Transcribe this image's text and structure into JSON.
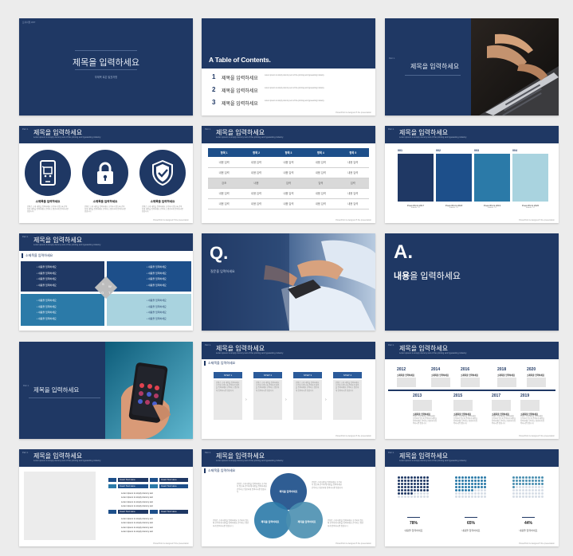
{
  "common": {
    "title": "제목을 입력하세요",
    "subtitle_line": "Lorem ipsum is simply dummy text of the printing and typesetting industry.",
    "footer": "PowerPoint is designed 5 the presentation",
    "page": "Part 1.",
    "content": "내용을 입력하세요",
    "small_title": "소제목을 입력하세요",
    "lorem": "Lorem ipsum is simply dummy text of the printing and typesetting industry.",
    "kor_lorem": "콘텐츠 소개 내용을 입력하세요 조각하지 않도록 간략하게 내용을 입력하세요 간략하고 명료하게 입력하시면 좋습니다"
  },
  "slide1": {
    "top_label": "프리미엄 PPT",
    "title": "제목을 입력하세요",
    "sub": "부제목 혹은 발표자명"
  },
  "slide2": {
    "heading": "A Table of Contents.",
    "items": [
      {
        "num": "1",
        "label": "제목을 입력하세요"
      },
      {
        "num": "2",
        "label": "제목을 입력하세요"
      },
      {
        "num": "3",
        "label": "제목을 입력하세요"
      }
    ]
  },
  "slide3": {
    "title": "제목을 입력하세요"
  },
  "slide4": {
    "title": "제목을 입력하세요",
    "items": [
      {
        "icon": "mobile-shopping-cart-icon",
        "label": "소제목을 입력하세요"
      },
      {
        "icon": "padlock-icon",
        "label": "소제목을 입력하세요"
      },
      {
        "icon": "shield-check-icon",
        "label": "소제목을 입력하세요"
      }
    ]
  },
  "slide5": {
    "title": "제목을 입력하세요",
    "columns": [
      "항목 1",
      "항목 2",
      "항목 3",
      "항목 4",
      "항목 5"
    ],
    "rows": [
      [
        "내용 입력",
        "내용 입력",
        "내용 입력",
        "내용 입력",
        "내용 입력"
      ],
      [
        "내용 입력",
        "내용 입력",
        "내용 입력",
        "내용 입력",
        "내용 입력"
      ],
      [
        "강조",
        "내용",
        "입력",
        "입력",
        "입력"
      ],
      [
        "내용 입력",
        "내용 입력",
        "내용 입력",
        "내용 입력",
        "내용 입력"
      ],
      [
        "내용 입력",
        "내용 입력",
        "내용 입력",
        "내용 입력",
        "내용 입력"
      ]
    ],
    "highlight_row": 2
  },
  "slide6": {
    "title": "제목을 입력하세요",
    "bars": [
      {
        "num": "001",
        "color": "#1f3864",
        "caption": "PowerPoint 2017",
        "sub": "Subtitle ###"
      },
      {
        "num": "002",
        "color": "#1d4f8a",
        "caption": "PowerPoint 2018",
        "sub": "Subtitle ###"
      },
      {
        "num": "003",
        "color": "#2b7aa8",
        "caption": "PowerPoint 2019",
        "sub": "Subtitle ###"
      },
      {
        "num": "004",
        "color": "#a9d3df",
        "caption": "PowerPoint 2020",
        "sub": "Subtitle ###"
      }
    ]
  },
  "slide7": {
    "title": "제목을 입력하세요",
    "small_title": "소제목을 입력하세요",
    "bullet": "내용을 입력하세요",
    "quad_letters": [
      "S",
      "W",
      "O",
      "T"
    ]
  },
  "slide8": {
    "big": "Q.",
    "sub": "질문을 입력하세요"
  },
  "slide9": {
    "big": "A.",
    "bold": "내용",
    "rest": "을 입력하세요"
  },
  "slide10": {
    "title": "제목을 입력하세요"
  },
  "slide11": {
    "title": "제목을 입력하세요",
    "small_title": "소제목을 입력하세요",
    "steps": [
      "STEP 1",
      "STEP 2",
      "STEP 3",
      "STEP 4"
    ]
  },
  "slide12": {
    "title": "제목을 입력하세요",
    "top_years": [
      "2012",
      "2014",
      "2016",
      "2018",
      "2020"
    ],
    "bottom_years": [
      "2013",
      "2015",
      "2017",
      "2019"
    ],
    "label": "소제목을 입력하세요"
  },
  "slide13": {
    "title": "제목을 입력하세요",
    "insert_title": "Insert Text Here",
    "list_item": "Lorem Ipsum is simply dummy text"
  },
  "slide14": {
    "title": "제목을 입력하세요",
    "small_title": "소제목을 입력하세요",
    "venn": [
      "제목을 입력하세요",
      "제목을 입력하세요",
      "제목을 입력하세요"
    ],
    "venn_colors": [
      "#1d4f8a",
      "#2b7aa8",
      "#4a8fb0"
    ]
  },
  "slide15": {
    "title": "제목을 입력하세요",
    "stats": [
      {
        "pct": "78%",
        "value": 0.78,
        "label": "내용을 입력하세요"
      },
      {
        "pct": "65%",
        "value": 0.65,
        "label": "내용을 입력하세요"
      },
      {
        "pct": "44%",
        "value": 0.44,
        "label": "내용을 입력하세요"
      }
    ],
    "dot_colors": [
      "#1f3864",
      "#2b7aa8",
      "#4a8fb0"
    ]
  }
}
